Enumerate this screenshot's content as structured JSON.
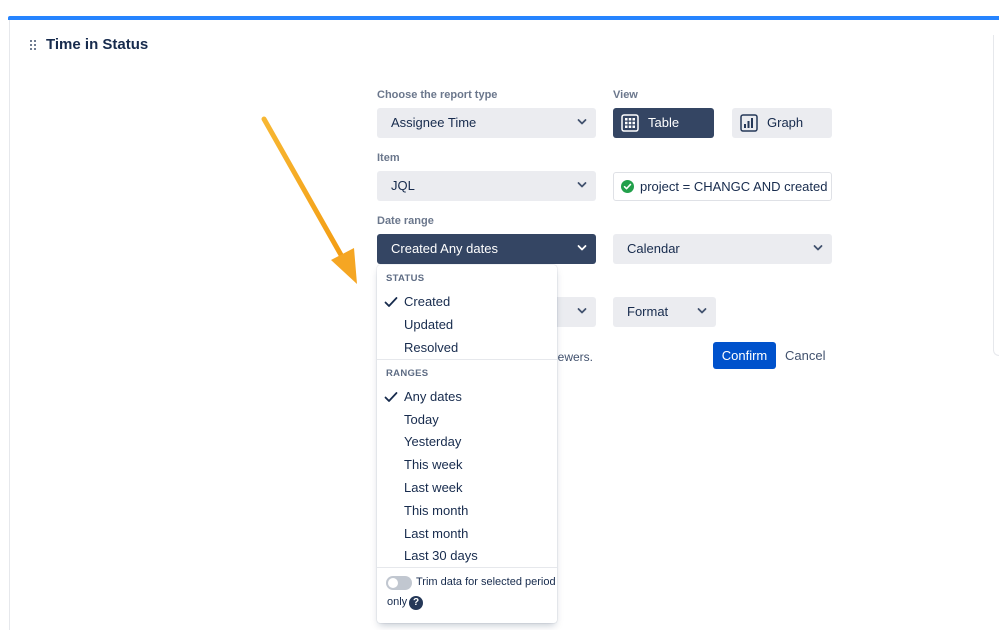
{
  "panel": {
    "title": "Time in Status"
  },
  "report_type": {
    "label": "Choose the report type",
    "value": "Assignee Time"
  },
  "view": {
    "label": "View",
    "table_label": "Table",
    "graph_label": "Graph",
    "selected": "Table"
  },
  "item": {
    "label": "Item",
    "value": "JQL",
    "jql_query": "project = CHANGC AND created >="
  },
  "date_range": {
    "label": "Date range",
    "value": "Created Any dates",
    "calendar_value": "Calendar"
  },
  "format": {
    "value": "Format"
  },
  "behind_text": "iewers.",
  "actions": {
    "confirm_label": "Confirm",
    "cancel_label": "Cancel"
  },
  "dropdown": {
    "status_header": "STATUS",
    "status_items": [
      "Created",
      "Updated",
      "Resolved"
    ],
    "status_selected": "Created",
    "ranges_header": "RANGES",
    "range_items": [
      "Any dates",
      "Today",
      "Yesterday",
      "This week",
      "Last week",
      "This month",
      "Last month",
      "Last 30 days"
    ],
    "range_selected": "Any dates",
    "trim_label_line1": "Trim data for selected period",
    "trim_label_line2": "only",
    "trim_enabled": false,
    "help_glyph": "?"
  },
  "colors": {
    "accent_bar": "#2684ff",
    "primary_button": "#0052cc",
    "dark_select": "#344563",
    "success": "#36b37e",
    "annotation_arrow": "#f5a623"
  },
  "icons": [
    "drag-handle-icon",
    "chevron-down-icon",
    "table-grid-icon",
    "bar-chart-icon",
    "check-circle-icon",
    "checkmark-icon",
    "help-icon"
  ]
}
